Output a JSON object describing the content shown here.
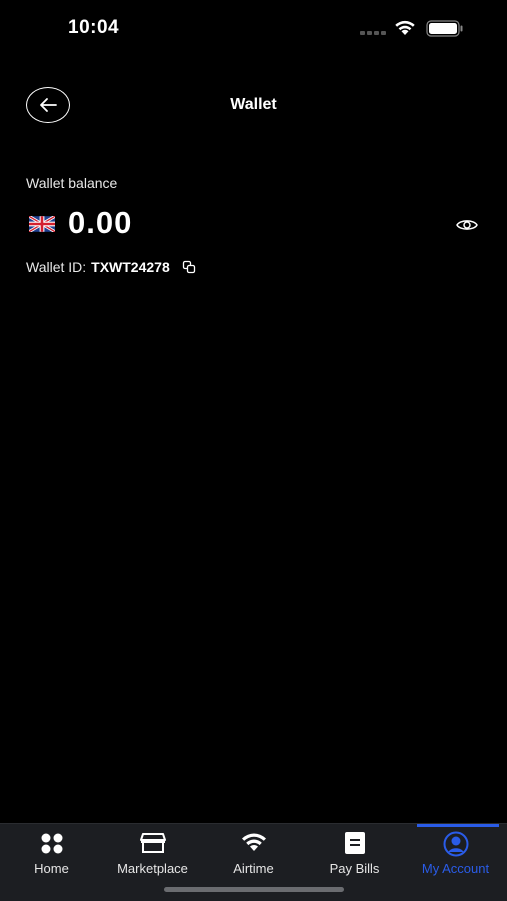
{
  "status_bar": {
    "time": "10:04"
  },
  "header": {
    "title": "Wallet"
  },
  "wallet": {
    "balance_label": "Wallet balance",
    "balance": "0.00",
    "currency_flag": "uk-flag-icon",
    "id_label": "Wallet ID:",
    "id_value": "TXWT24278"
  },
  "tab_bar": {
    "items": [
      {
        "label": "Home",
        "icon": "home-grid-icon"
      },
      {
        "label": "Marketplace",
        "icon": "storefront-icon"
      },
      {
        "label": "Airtime",
        "icon": "wifi-icon"
      },
      {
        "label": "Pay Bills",
        "icon": "document-icon"
      },
      {
        "label": "My Account",
        "icon": "user-icon",
        "active": true
      }
    ]
  },
  "colors": {
    "background": "#000000",
    "tab_bar": "#1c1e22",
    "accent": "#2a5ce8"
  }
}
